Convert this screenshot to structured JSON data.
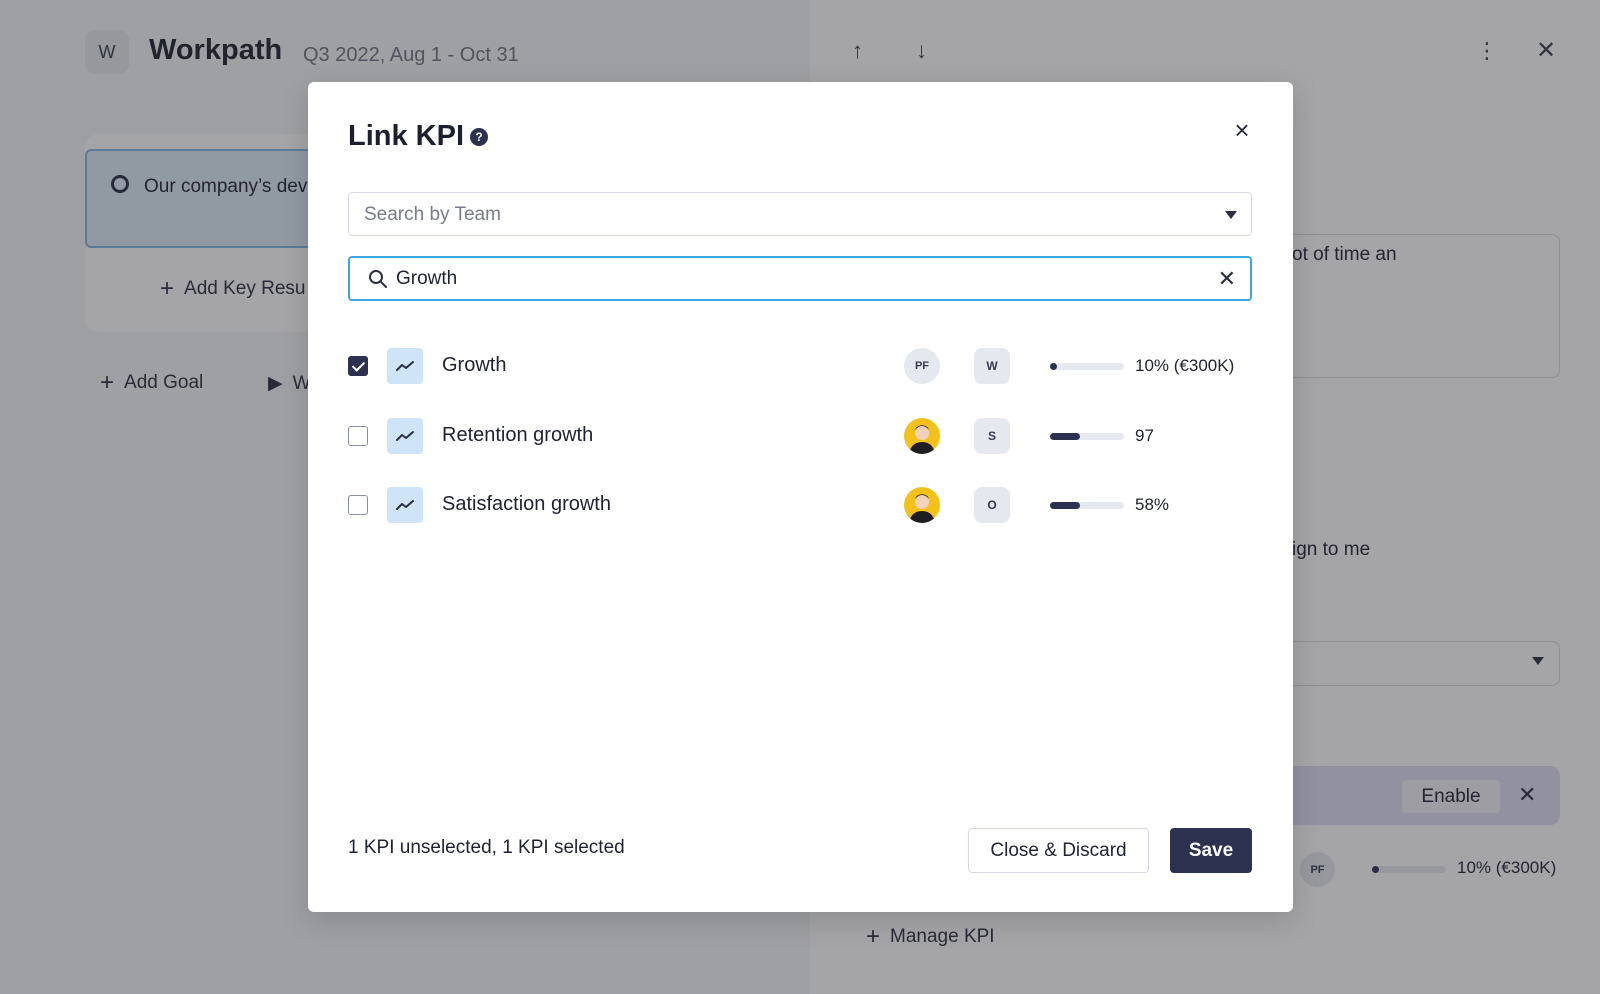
{
  "workspace": {
    "badge": "W",
    "title": "Workpath",
    "period": "Q3 2022, Aug 1 - Oct 31"
  },
  "goal": {
    "text": "Our company’s dev higher quality, so w"
  },
  "actions": {
    "add_key_result": "Add Key Resu",
    "add_goal": "Add Goal",
    "toggle": "W"
  },
  "right_panel": {
    "description_fragment": "ot of time an",
    "assign_fragment": "ign to me",
    "enable_label": "Enable",
    "kpi_owner": "PF",
    "kpi_progress": 0.1,
    "kpi_value": "10% (€300K)",
    "manage_kpi": "Manage KPI"
  },
  "modal": {
    "title": "Link KPI",
    "help": "?",
    "team_placeholder": "Search by Team",
    "search_value": "Growth",
    "rows": [
      {
        "name": "Growth",
        "checked": true,
        "owner": "PF",
        "team": "W",
        "progress": 0.1,
        "value": "10% (€300K)"
      },
      {
        "name": "Retention growth",
        "checked": false,
        "owner": "",
        "team": "S",
        "progress": 0.4,
        "value": "97"
      },
      {
        "name": "Satisfaction growth",
        "checked": false,
        "owner": "",
        "team": "O",
        "progress": 0.4,
        "value": "58%"
      }
    ],
    "status": "1 KPI unselected, 1 KPI selected",
    "discard_label": "Close & Discard",
    "save_label": "Save"
  },
  "colors": {
    "primary": "#2c3150",
    "focus": "#3da8e6",
    "trend_bg": "#cfe4f7",
    "avatar_photo": "#f2c21a"
  }
}
